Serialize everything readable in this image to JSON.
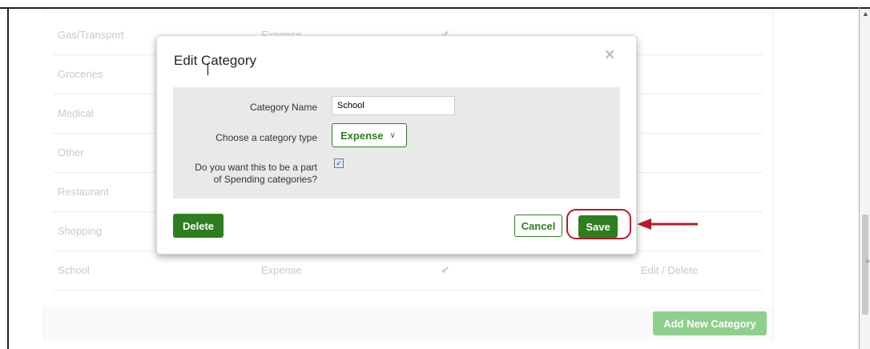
{
  "table": {
    "rows": [
      {
        "name": "Gas/Transport",
        "type": "Expense",
        "spending": "✔",
        "actions": ""
      },
      {
        "name": "Groceries",
        "type": "",
        "spending": "",
        "actions": ""
      },
      {
        "name": "Medical",
        "type": "",
        "spending": "",
        "actions": ""
      },
      {
        "name": "Other",
        "type": "",
        "spending": "",
        "actions": ""
      },
      {
        "name": "Restaurant",
        "type": "",
        "spending": "",
        "actions": ""
      },
      {
        "name": "Shopping",
        "type": "",
        "spending": "",
        "actions": ""
      },
      {
        "name": "School",
        "type": "Expense",
        "spending": "✔",
        "actions": "Edit / Delete"
      }
    ],
    "add_button": "Add New Category"
  },
  "modal": {
    "title": "Edit Category",
    "close_icon": "×",
    "name_label": "Category Name",
    "name_value": "School",
    "type_label": "Choose a category type",
    "type_value": "Expense",
    "spending_label_line1": "Do you want this to be a part",
    "spending_label_line2": "of Spending categories?",
    "spending_checked": true,
    "delete_label": "Delete",
    "cancel_label": "Cancel",
    "save_label": "Save"
  },
  "colors": {
    "primary_green": "#2e7d1f",
    "faded_green": "#8fcf8d",
    "annotation_red": "#b31c2a"
  }
}
